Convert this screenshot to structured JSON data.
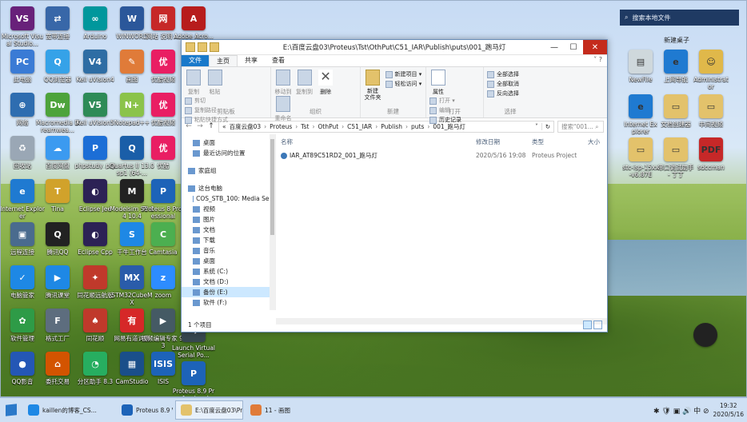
{
  "desktop": {
    "icons_col1": [
      {
        "label": "Microsoft Visual Studio...",
        "color": "#68217a",
        "glyph": "VS"
      },
      {
        "label": "此电脑",
        "color": "#3a7bd5",
        "glyph": "PC"
      },
      {
        "label": "网络",
        "color": "#2e6db0",
        "glyph": "⊕"
      },
      {
        "label": "回收站",
        "color": "#9aa7b5",
        "glyph": "♻"
      },
      {
        "label": "Internet Explorer",
        "color": "#1f7ad1",
        "glyph": "e"
      },
      {
        "label": "远程连接",
        "color": "#4a6b8e",
        "glyph": "▣"
      },
      {
        "label": "电脑管家",
        "color": "#1e88e5",
        "glyph": "✓"
      },
      {
        "label": "软件管理",
        "color": "#2e9b47",
        "glyph": "✿"
      },
      {
        "label": "QQ影音",
        "color": "#2457b5",
        "glyph": "●"
      }
    ],
    "icons_col2": [
      {
        "label": "宽带连接",
        "color": "#3867a8",
        "glyph": "⇄"
      },
      {
        "label": "QQ浏览器",
        "color": "#35a2e8",
        "glyph": "Q"
      },
      {
        "label": "Macromedia Dreamwea...",
        "color": "#4da33b",
        "glyph": "Dw"
      },
      {
        "label": "百度网盘",
        "color": "#3b9af0",
        "glyph": "☁"
      },
      {
        "label": "Tina",
        "color": "#d1a22b",
        "glyph": "T"
      },
      {
        "label": "腾讯QQ",
        "color": "#222222",
        "glyph": "Q"
      },
      {
        "label": "腾讯课堂",
        "color": "#1e88e5",
        "glyph": "▶"
      },
      {
        "label": "格式工厂",
        "color": "#5d6d7e",
        "glyph": "F"
      },
      {
        "label": "委托交易",
        "color": "#d35400",
        "glyph": "⌂"
      }
    ],
    "icons_col3": [
      {
        "label": "Arduino",
        "color": "#00979c",
        "glyph": "∞"
      },
      {
        "label": "Keil uVision4",
        "color": "#2e6da4",
        "glyph": "V4"
      },
      {
        "label": "Keil uVision5",
        "color": "#2e8b57",
        "glyph": "V5"
      },
      {
        "label": "phpstudy_pro",
        "color": "#1c6ed6",
        "glyph": "P"
      },
      {
        "label": "Eclipse Jee",
        "color": "#2c2255",
        "glyph": "◐"
      },
      {
        "label": "Eclipse Cpp",
        "color": "#2c2255",
        "glyph": "◐"
      },
      {
        "label": "同花顺远航版",
        "color": "#c0392b",
        "glyph": "✦"
      },
      {
        "label": "同花顺",
        "color": "#c0392b",
        "glyph": "♠"
      },
      {
        "label": "分区助手 8.3",
        "color": "#27ae60",
        "glyph": "◔"
      }
    ],
    "icons_col4": [
      {
        "label": "WINWORD",
        "color": "#2b579a",
        "glyph": "W"
      },
      {
        "label": "画图",
        "color": "#e07b39",
        "glyph": "✎"
      },
      {
        "label": "Notepad++",
        "color": "#8bc34a",
        "glyph": "N+"
      },
      {
        "label": "Quartus II 13.0sp1 (64-...",
        "color": "#1a5ea8",
        "glyph": "Q"
      },
      {
        "label": "Modelsim SE-64 10.4",
        "color": "#222222",
        "glyph": "M"
      },
      {
        "label": "千牛工作台",
        "color": "#1e88e5",
        "glyph": "S"
      },
      {
        "label": "STM32CubeMX",
        "color": "#2a5caa",
        "glyph": "MX"
      },
      {
        "label": "网易有道词典",
        "color": "#d62828",
        "glyph": "有"
      },
      {
        "label": "CamStudio",
        "color": "#1a4f8a",
        "glyph": "▦"
      }
    ],
    "icons_col5": [
      {
        "label": "网站 说明 ...",
        "color": "#c62828",
        "glyph": "网"
      },
      {
        "label": "优酷视频",
        "color": "#e91e63",
        "glyph": "优"
      },
      {
        "label": "优酷视频",
        "color": "#e91e63",
        "glyph": "优"
      },
      {
        "label": "优酷",
        "color": "#e91e63",
        "glyph": "优"
      },
      {
        "label": "Proteus 8 Professional",
        "color": "#1d63b8",
        "glyph": "P"
      },
      {
        "label": "Camtasia",
        "color": "#4caf50",
        "glyph": "C"
      },
      {
        "label": "zoom",
        "color": "#2d8cff",
        "glyph": "z"
      },
      {
        "label": "视频编辑专家 9.3",
        "color": "#455a64",
        "glyph": "▶"
      },
      {
        "label": "ISIS",
        "color": "#1d63b8",
        "glyph": "ISIS"
      }
    ],
    "icons_col6": [
      {
        "label": "Adobe Acro...",
        "color": "#b71c1c",
        "glyph": "A"
      },
      {
        "label": "Launch Virtual Serial Po...",
        "color": "#37474f",
        "glyph": "⇆"
      },
      {
        "label": "Proteus 8.9 Professional",
        "color": "#1d63b8",
        "glyph": "P"
      }
    ],
    "icons_right": [
      {
        "label": "NewFile",
        "color": "#cfd8dc",
        "glyph": "▤"
      },
      {
        "label": "上网导航",
        "color": "#1f7ad1",
        "glyph": "e"
      },
      {
        "label": "Administrator",
        "color": "#e0b84a",
        "glyph": "☺"
      },
      {
        "label": "Internet Explorer",
        "color": "#1f7ad1",
        "glyph": "e"
      },
      {
        "label": "文档创建器",
        "color": "#e3c26b",
        "glyph": "▭"
      },
      {
        "label": "中间视频",
        "color": "#e3c26b",
        "glyph": "▭"
      },
      {
        "label": "stc-isp-15xx-v6.87E",
        "color": "#e3c26b",
        "glyph": "▭"
      },
      {
        "label": "串口调试助手 - 丁丁",
        "color": "#e3c26b",
        "glyph": "▭"
      },
      {
        "label": "sdccman",
        "color": "#c62828",
        "glyph": "PDF"
      }
    ],
    "search_placeholder": "搜索本地文件",
    "new_folder_label": "新建桌子"
  },
  "window": {
    "title": "E:\\百度云盘03\\Proteus\\Tst\\OthPut\\C51_IAR\\Publish\\puts\\001_跑马灯",
    "controls": {
      "minimize": "—",
      "maximize": "☐",
      "close": "✕"
    },
    "tabs": [
      {
        "label": "文件"
      },
      {
        "label": "主页"
      },
      {
        "label": "共享"
      },
      {
        "label": "查看"
      }
    ],
    "help_glyph": "˅ ?",
    "ribbon": {
      "clipboard": {
        "name": "剪贴板",
        "copy": "复制",
        "paste": "粘贴",
        "cut": "剪切",
        "copy_path": "复制路径",
        "paste_shortcut": "粘贴快捷方式"
      },
      "organize": {
        "name": "组织",
        "move_to": "移动到",
        "copy_to": "复制到",
        "delete": "删除",
        "rename": "重命名"
      },
      "new": {
        "name": "新建",
        "new_folder": "新建\n文件夹",
        "new_item": "新建项目 ▾",
        "easy_access": "轻松访问 ▾"
      },
      "open": {
        "name": "打开",
        "properties": "属性",
        "open": "打开 ▾",
        "edit": "编辑",
        "history": "历史记录"
      },
      "select": {
        "name": "选择",
        "select_all": "全部选择",
        "select_none": "全部取消",
        "invert": "反向选择"
      }
    },
    "address": {
      "back": "←",
      "forward": "→",
      "up": "↑",
      "overflow": "«",
      "crumbs": [
        "百度云盘03",
        "Proteus",
        "Tst",
        "OthPut",
        "C51_IAR",
        "Publish",
        "puts",
        "001_跑马灯"
      ],
      "dropdown": "˅",
      "refresh": "↻",
      "search_placeholder": "搜索\"001...  ⌕"
    },
    "nav": [
      {
        "label": "桌面",
        "gap": false
      },
      {
        "label": "最近访问的位置",
        "gap": false
      },
      {
        "label": "家庭组",
        "gap": true
      },
      {
        "label": "这台电脑",
        "gap": true
      },
      {
        "label": "COS_STB_100: Media Serv",
        "gap": false
      },
      {
        "label": "视频",
        "gap": false
      },
      {
        "label": "图片",
        "gap": false
      },
      {
        "label": "文档",
        "gap": false
      },
      {
        "label": "下载",
        "gap": false
      },
      {
        "label": "音乐",
        "gap": false
      },
      {
        "label": "桌面",
        "gap": false
      },
      {
        "label": "系统 (C:)",
        "gap": false
      },
      {
        "label": "文档 (D:)",
        "gap": false
      },
      {
        "label": "备份 (E:)",
        "gap": false,
        "selected": true
      },
      {
        "label": "软件 (F:)",
        "gap": false
      }
    ],
    "columns": {
      "name": "名称",
      "modified": "修改日期",
      "type": "类型",
      "size": "大小"
    },
    "files": [
      {
        "name": "IAR_AT89C51RD2_001_跑马灯",
        "modified": "2020/5/16 19:08",
        "type": "Proteus Project"
      }
    ],
    "status": "1 个项目"
  },
  "taskbar": {
    "items": [
      {
        "label": "kaillen的博客_CS...",
        "color": "#1e88e5",
        "active": false
      },
      {
        "label": "Proteus 8.9 VSM...",
        "color": "#1d63b8",
        "active": false
      },
      {
        "label": "E:\\百度云盘03\\Pr...",
        "color": "#e3c26b",
        "active": true
      },
      {
        "label": "11 - 画图",
        "color": "#e07b39",
        "active": false
      }
    ],
    "tray": {
      "icons": "✱ 🛡 ▣ 🔊 中 ⊘",
      "time": "19:32",
      "date": "2020/5/16"
    }
  }
}
